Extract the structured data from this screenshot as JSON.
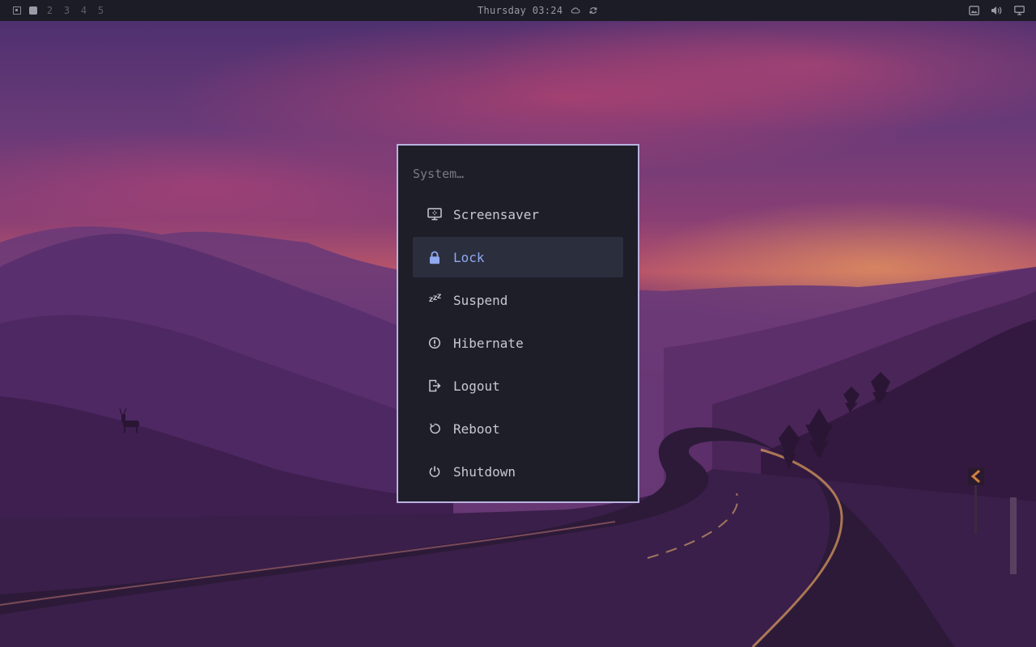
{
  "topbar": {
    "workspaces": [
      "2",
      "3",
      "4",
      "5"
    ],
    "active_workspace_icon": "filled-square",
    "layout_icon": "layout-icon",
    "clock": "Thursday 03:24",
    "status_icons": [
      "cloud-icon",
      "refresh-icon"
    ],
    "tray_icons": [
      "image-icon",
      "volume-icon",
      "monitor-icon"
    ]
  },
  "menu": {
    "prompt": "System…",
    "selected_index": 1,
    "accent_color": "#8fa8f0",
    "border_color": "#b9b2e0",
    "items": [
      {
        "label": "Screensaver",
        "icon": "screensaver-icon"
      },
      {
        "label": "Lock",
        "icon": "lock-icon"
      },
      {
        "label": "Suspend",
        "icon": "sleep-zzz-icon"
      },
      {
        "label": "Hibernate",
        "icon": "hibernate-icon"
      },
      {
        "label": "Logout",
        "icon": "logout-icon"
      },
      {
        "label": "Reboot",
        "icon": "reboot-icon"
      },
      {
        "label": "Shutdown",
        "icon": "power-icon"
      }
    ]
  }
}
